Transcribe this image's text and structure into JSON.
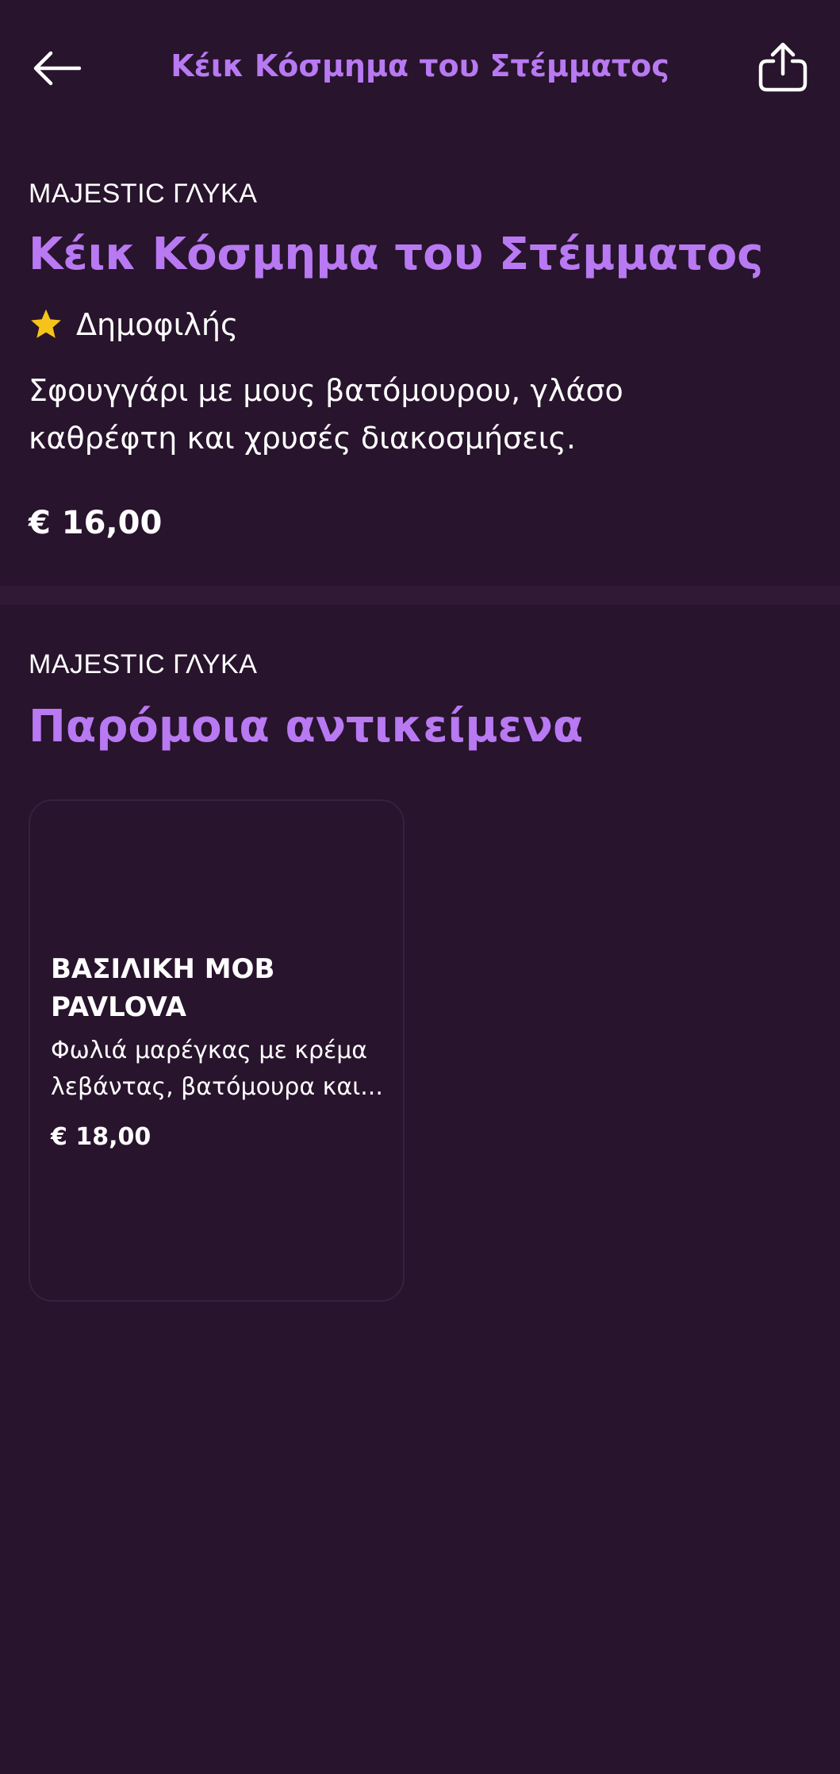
{
  "topbar": {
    "title": "Κέικ Κόσμημα του Στέμματος"
  },
  "product": {
    "eyebrow": "MAJESTIC ΓΛΥΚΑ",
    "title": "Κέικ Κόσμημα του Στέμματος",
    "badge_icon": "star-icon",
    "badge_label": "Δημοφιλής",
    "description": "Σφουγγάρι με μους βατόμουρου, γλάσο καθρέφτη και χρυσές διακοσμήσεις.",
    "price": "€ 16,00"
  },
  "similar": {
    "eyebrow": "MAJESTIC ΓΛΥΚΑ",
    "title": "Παρόμοια αντικείμενα",
    "items": [
      {
        "name": "ΒΑΣΙΛΙΚΗ ΜΟΒ PAVLOVA",
        "description": "Φωλιά μαρέγκας με κρέμα λεβάντας, βατόμουρα και...",
        "price": "€ 18,00"
      }
    ]
  },
  "colors": {
    "background": "#28142c",
    "accent": "#b879f2",
    "star": "#f5c31a",
    "divider": "#2f1935"
  }
}
